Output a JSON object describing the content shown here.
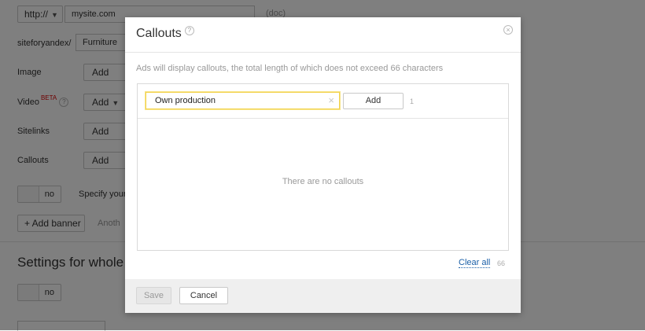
{
  "background": {
    "protocol": "http://",
    "site_value": "mysite.com",
    "domain_fragment": "(doc)",
    "path_label": "siteforyandex/",
    "path_value": "Furniture",
    "image_label": "Image",
    "image_button": "Add",
    "video_label": "Video",
    "video_beta": "BETA",
    "video_button": "Add",
    "sitelinks_label": "Sitelinks",
    "sitelinks_button": "Add",
    "callouts_label": "Callouts",
    "callouts_button": "Add",
    "toggle_value": "no",
    "specify_text": "Specify your",
    "add_banner_button": "+ Add banner",
    "another_text": "Anoth",
    "settings_title": "Settings for whole g",
    "settings_toggle_value": "no"
  },
  "modal": {
    "title": "Callouts",
    "hint": "Ads will display callouts, the total length of which does not exceed 66 characters",
    "input_value": "Own production",
    "add_button": "Add",
    "counter": "1",
    "empty_text": "There are no callouts",
    "clear_all": "Clear all",
    "total_count": "66",
    "save_button": "Save",
    "cancel_button": "Cancel"
  },
  "icons": {
    "help": "question-icon",
    "close": "close-icon",
    "clear": "clear-input-icon",
    "dropdown": "chevron-down-icon"
  },
  "colors": {
    "overlay": "#808080",
    "input_focus_border": "#f2d24c",
    "link": "#1a5fa8",
    "footer_bg": "#efefef"
  }
}
